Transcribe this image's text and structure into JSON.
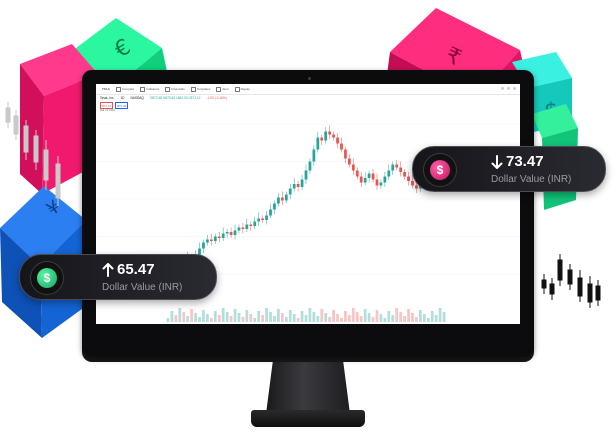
{
  "screen": {
    "symbol": "TSLA",
    "toolbar": [
      {
        "label": "Compare",
        "icon": "compare-icon"
      },
      {
        "label": "Indicators",
        "icon": "indicators-icon"
      },
      {
        "label": "Financials",
        "icon": "financials-icon"
      },
      {
        "label": "Templates",
        "icon": "templates-icon"
      },
      {
        "label": "Alert",
        "icon": "alert-icon"
      },
      {
        "label": "Replay",
        "icon": "replay-icon"
      }
    ],
    "company": "Tesla, Inc.",
    "interval": "1D",
    "exchange": "NASDAQ",
    "ohlc_text": "O872.65 H879.83 L862.30 C871.12",
    "change_text": "-1.53 (-0.18%)",
    "sell_price": "871.12",
    "buy_price": "871.40",
    "volume_label": "Vol",
    "volume_value": "15.09M"
  },
  "chart_data": {
    "type": "candlestick",
    "description_visible": "daily price candles with volume bars",
    "up_color": "#26a69a",
    "down_color": "#ef5350",
    "approx_close_series": [
      40,
      42,
      41,
      44,
      43,
      46,
      45,
      48,
      52,
      56,
      58,
      57,
      60,
      59,
      62,
      63,
      61,
      64,
      66,
      65,
      68,
      67,
      70,
      72,
      71,
      74,
      78,
      82,
      86,
      84,
      88,
      92,
      95,
      93,
      98,
      104,
      110,
      118,
      126,
      124,
      130,
      128,
      126,
      122,
      118,
      112,
      108,
      104,
      100,
      96,
      99,
      102,
      98,
      94,
      96,
      100,
      104,
      108,
      106,
      103,
      100,
      97,
      94,
      92,
      95,
      98,
      101,
      104,
      108,
      112,
      115
    ]
  },
  "cards": {
    "left": {
      "value": "65.47",
      "label": "Dollar Value (INR)",
      "direction": "up",
      "icon": "dollar-coin-icon",
      "accent": "#2ee68a"
    },
    "right": {
      "value": "73.47",
      "label": "Dollar Value (INR)",
      "direction": "down",
      "icon": "dollar-coin-icon",
      "accent": "#f0418f"
    }
  },
  "colors": {
    "cube_green": "#14e38a",
    "cube_pink": "#f0196d",
    "cube_blue": "#1464d6",
    "cube_cyan": "#17d6c8"
  }
}
